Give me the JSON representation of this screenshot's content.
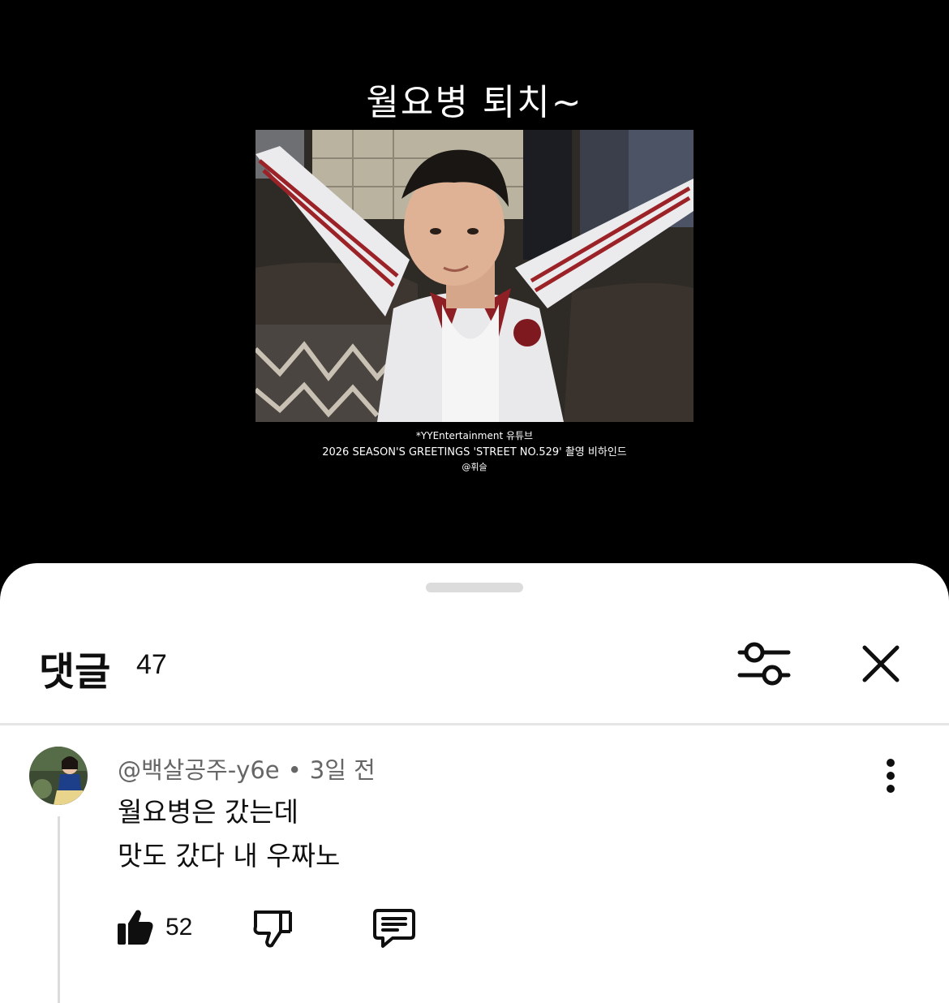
{
  "video": {
    "overlay_title": "월요병 퇴치~",
    "caption_line1": "*YYEntertainment 유튜브",
    "caption_line2": "2026 SEASON'S GREETINGS 'STREET NO.529' 촬영 비하인드",
    "caption_line3": "@휘슬"
  },
  "comments_panel": {
    "title": "댓글",
    "count": "47",
    "filter_icon": "sliders-icon",
    "close_icon": "close-icon"
  },
  "comment": {
    "author": "@백살공주-y6e",
    "separator": "•",
    "time": "3일 전",
    "lines": [
      "월요병은 갔는데",
      "맛도 갔다 내 우짜노"
    ],
    "likes": "52",
    "icons": {
      "like": "thumbs-up-icon",
      "dislike": "thumbs-down-icon",
      "reply": "comment-icon",
      "more": "more-vertical-icon"
    }
  }
}
